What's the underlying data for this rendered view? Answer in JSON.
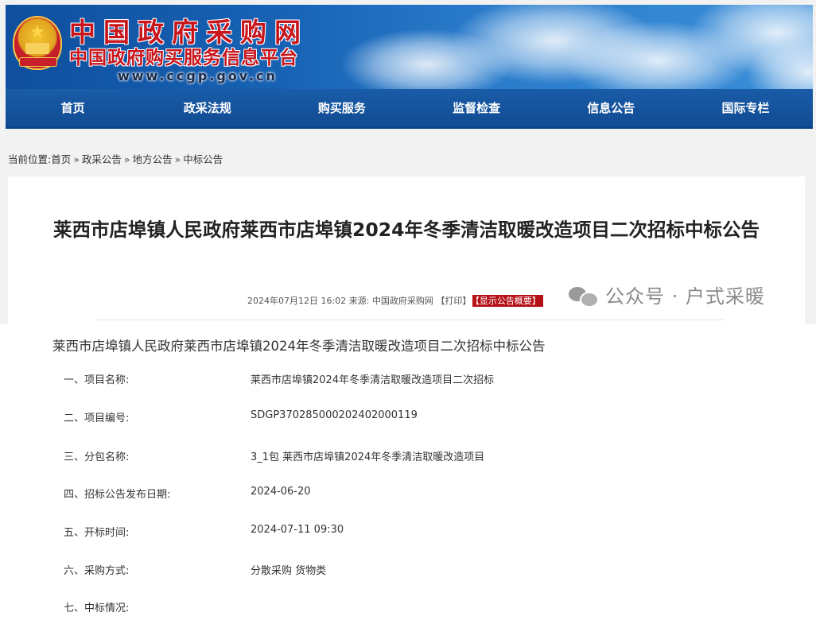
{
  "header": {
    "site_title": "中国政府采购网",
    "site_subtitle": "中国政府购买服务信息平台",
    "site_url": "www.ccgp.gov.cn"
  },
  "nav": {
    "items": [
      {
        "label": "首页"
      },
      {
        "label": "政采法规"
      },
      {
        "label": "购买服务"
      },
      {
        "label": "监督检查"
      },
      {
        "label": "信息公告"
      },
      {
        "label": "国际专栏"
      }
    ]
  },
  "breadcrumb": {
    "prefix": "当前位置:",
    "items": [
      "首页",
      "政采公告",
      "地方公告",
      "中标公告"
    ],
    "separator": "»"
  },
  "article": {
    "title": "莱西市店埠镇人民政府莱西市店埠镇2024年冬季清洁取暖改造项目二次招标中标公告",
    "date": "2024年07月12日 16:02",
    "source_label": "来源:",
    "source": "中国政府采购网",
    "print_label": "【打印】",
    "summary_label": "【显示公告概要】"
  },
  "watermark": {
    "text": "公众号 · 户式采暖"
  },
  "content": {
    "heading": "莱西市店埠镇人民政府莱西市店埠镇2024年冬季清洁取暖改造项目二次招标中标公告",
    "rows": [
      {
        "label": "一、项目名称:",
        "value": "莱西市店埠镇2024年冬季清洁取暖改造项目二次招标"
      },
      {
        "label": "二、项目编号:",
        "value": "SDGP370285000202402000119"
      },
      {
        "label": "三、分包名称:",
        "value": "3_1包 莱西市店埠镇2024年冬季清洁取暖改造项目"
      },
      {
        "label": "四、招标公告发布日期:",
        "value": "2024-06-20"
      },
      {
        "label": "五、开标时间:",
        "value": "2024-07-11 09:30"
      },
      {
        "label": "六、采购方式:",
        "value": "分散采购 货物类"
      },
      {
        "label": "七、中标情况:",
        "value": ""
      }
    ]
  },
  "colors": {
    "nav_bg": "#104b92",
    "title_red": "#c8141b",
    "summary_btn": "#b51218"
  }
}
